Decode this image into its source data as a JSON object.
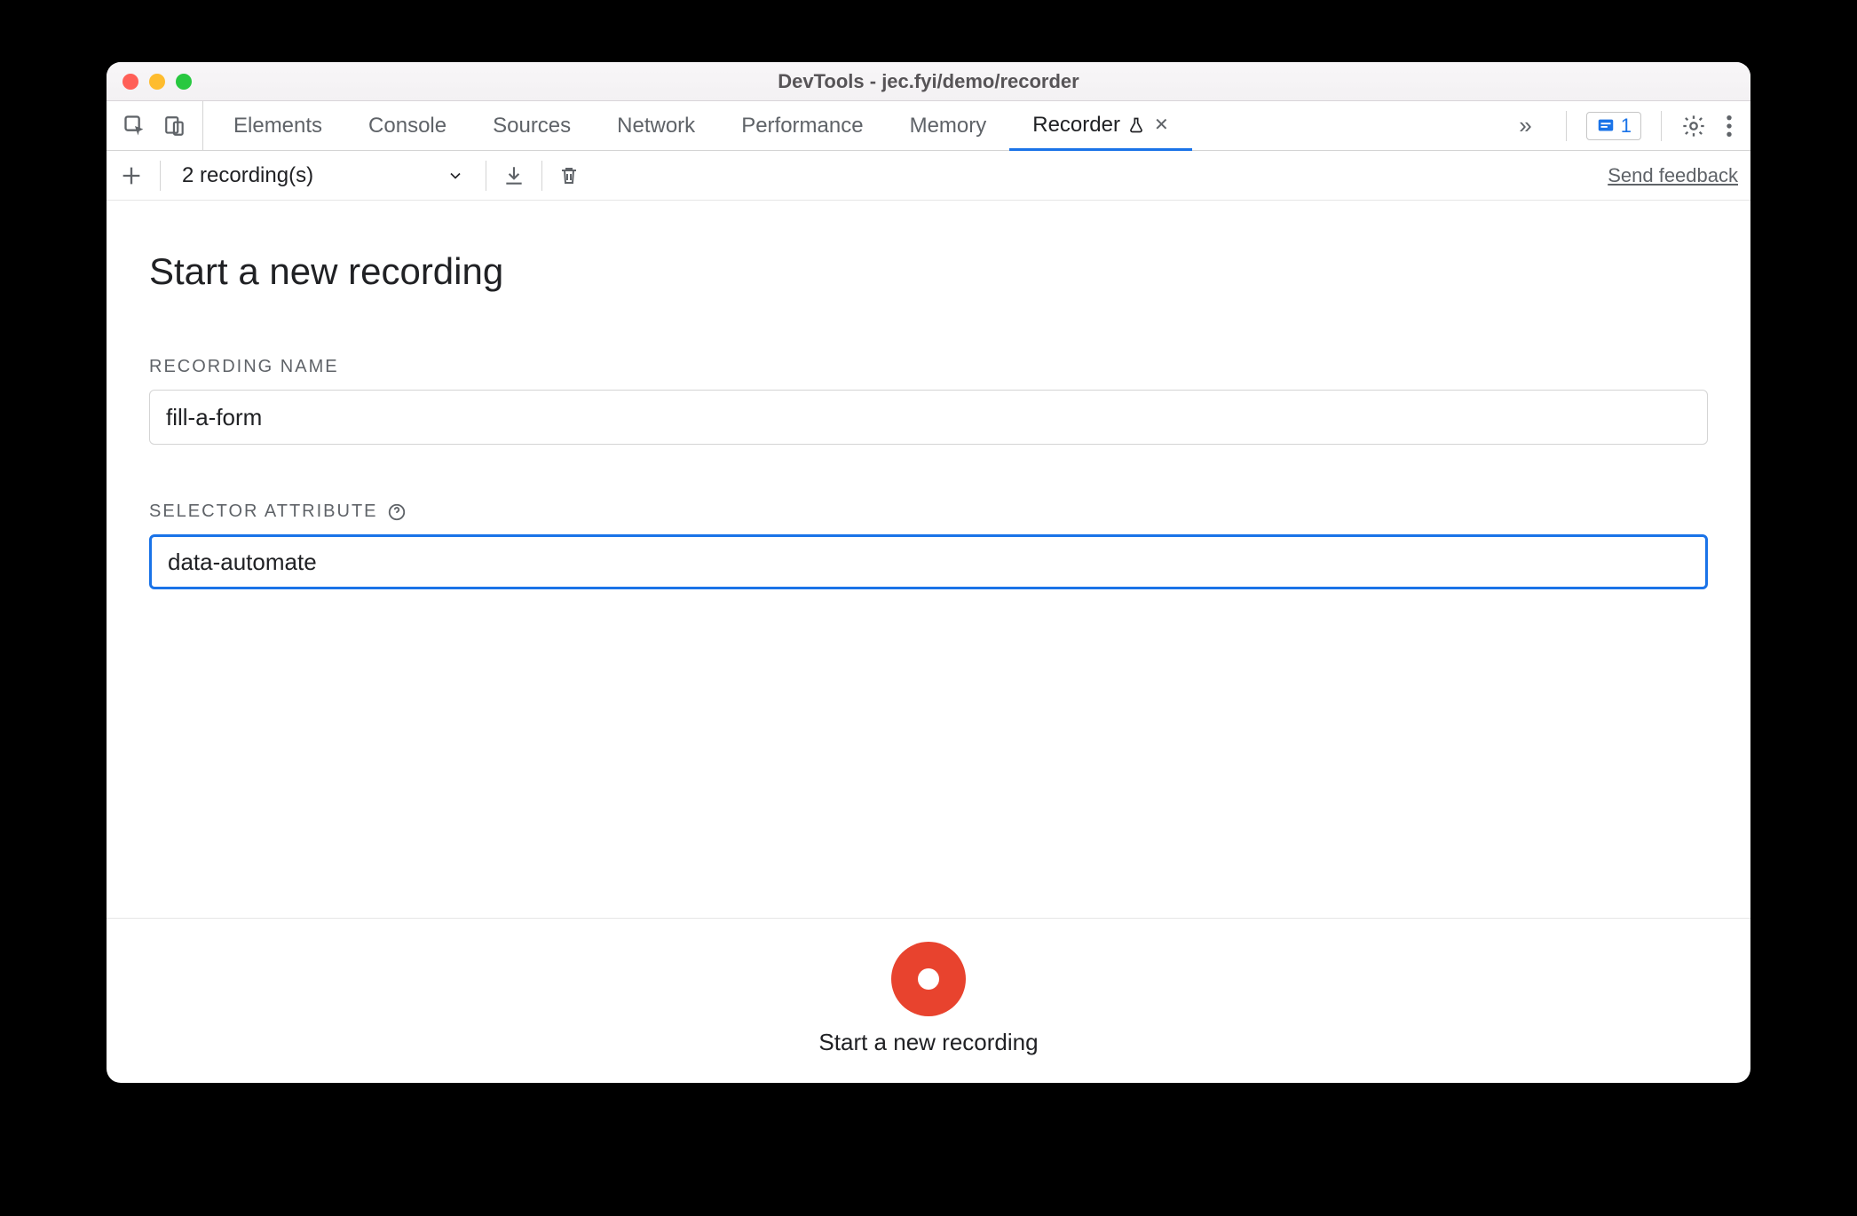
{
  "window": {
    "title": "DevTools - jec.fyi/demo/recorder"
  },
  "tabs": {
    "items": [
      {
        "label": "Elements",
        "active": false
      },
      {
        "label": "Console",
        "active": false
      },
      {
        "label": "Sources",
        "active": false
      },
      {
        "label": "Network",
        "active": false
      },
      {
        "label": "Performance",
        "active": false
      },
      {
        "label": "Memory",
        "active": false
      },
      {
        "label": "Recorder",
        "active": true,
        "experiment": true,
        "closable": true
      }
    ],
    "issues_count": "1"
  },
  "toolbar": {
    "recordings_label": "2 recording(s)",
    "feedback_label": "Send feedback"
  },
  "page": {
    "title": "Start a new recording",
    "fields": {
      "recording_name": {
        "label": "RECORDING NAME",
        "value": "fill-a-form"
      },
      "selector_attribute": {
        "label": "SELECTOR ATTRIBUTE",
        "value": "data-automate"
      }
    }
  },
  "footer": {
    "label": "Start a new recording"
  }
}
